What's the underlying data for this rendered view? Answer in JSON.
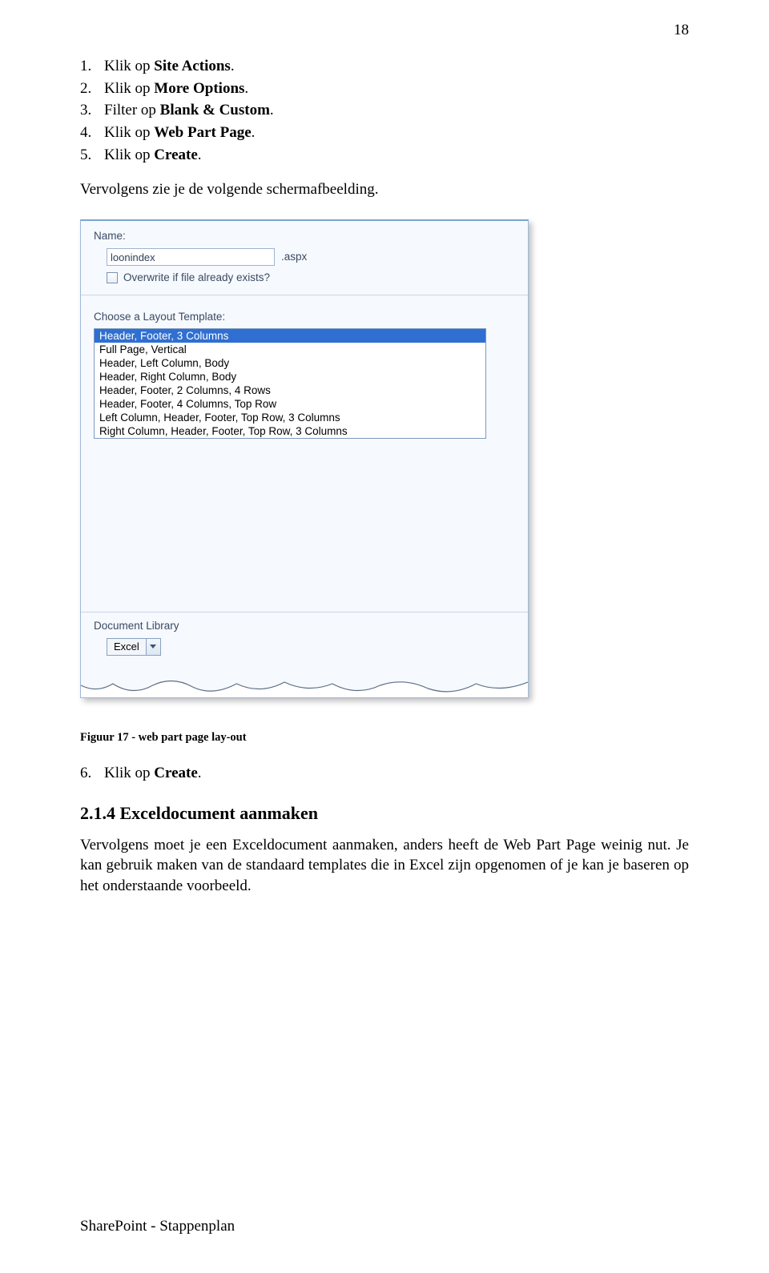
{
  "page_number": "18",
  "steps_a": [
    {
      "num": "1.",
      "pre": "Klik op ",
      "bold": "Site Actions",
      "post": "."
    },
    {
      "num": "2.",
      "pre": "Klik op ",
      "bold": "More Options",
      "post": "."
    },
    {
      "num": "3.",
      "pre": "Filter op ",
      "bold": "Blank & Custom",
      "post": "."
    },
    {
      "num": "4.",
      "pre": "Klik op ",
      "bold": "Web Part Page",
      "post": "."
    },
    {
      "num": "5.",
      "pre": "Klik op ",
      "bold": "Create",
      "post": "."
    }
  ],
  "intro_after_steps": "Vervolgens zie je de volgende schermafbeelding.",
  "shot": {
    "name_label": "Name:",
    "name_value": "loonindex",
    "name_suffix": ".aspx",
    "overwrite_label": "Overwrite if file already exists?",
    "layout_label": "Choose a Layout Template:",
    "layout_items": [
      "Header, Footer, 3 Columns",
      "Full Page, Vertical",
      "Header, Left Column, Body",
      "Header, Right Column, Body",
      "Header, Footer, 2 Columns, 4 Rows",
      "Header, Footer, 4 Columns, Top Row",
      "Left Column, Header, Footer, Top Row, 3 Columns",
      "Right Column, Header, Footer, Top Row, 3 Columns"
    ],
    "doclib_label": "Document Library",
    "doclib_selected": "Excel"
  },
  "fig_caption": "Figuur 17 - web part page lay-out",
  "step6": {
    "num": "6.",
    "pre": "Klik op ",
    "bold": "Create",
    "post": "."
  },
  "section_heading": "2.1.4  Exceldocument aanmaken",
  "body_text": "Vervolgens moet je een Exceldocument aanmaken, anders heeft de Web Part Page weinig nut. Je kan gebruik maken van de standaard templates die in Excel zijn opgenomen of je kan je baseren op het onderstaande voorbeeld.",
  "footer": "SharePoint - Stappenplan"
}
